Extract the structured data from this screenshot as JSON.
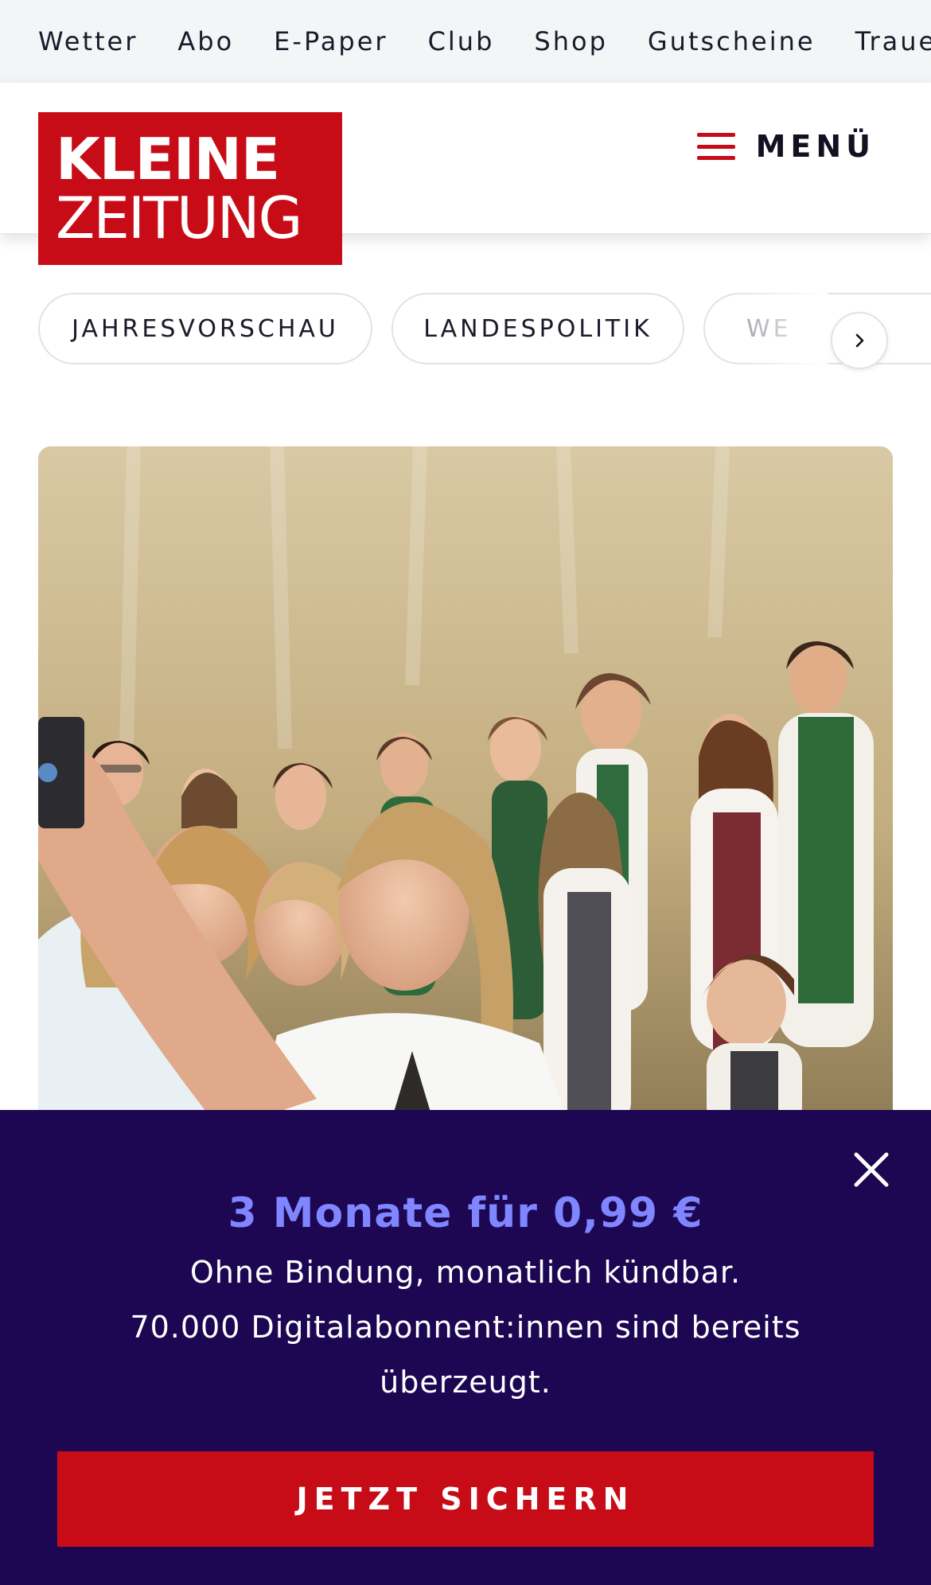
{
  "topnav": {
    "items": [
      "Wetter",
      "Abo",
      "E-Paper",
      "Club",
      "Shop",
      "Gutscheine",
      "Trauerpo"
    ]
  },
  "header": {
    "logo": {
      "line1": "KLEINE",
      "line2": "ZEITUNG",
      "color": "#c70c17"
    },
    "menu_label": "MENÜ"
  },
  "chips": {
    "items": [
      "JAHRESVORSCHAU",
      "LANDESPOLITIK",
      "WE"
    ]
  },
  "hero": {
    "image": "photo-people-selfie-at-ball"
  },
  "promo": {
    "headline": "3 Monate für 0,99 €",
    "line1": "Ohne Bindung, monatlich kündbar.",
    "line2": "70.000 Digitalabonnent:innen sind bereits",
    "line3": "überzeugt.",
    "cta": "JETZT SICHERN",
    "background": "#1d0652",
    "accent": "#7f86ff"
  }
}
